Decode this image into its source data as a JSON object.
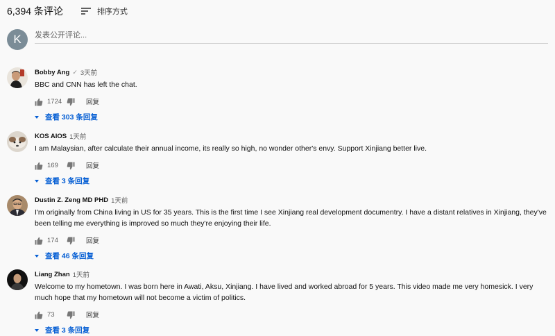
{
  "header": {
    "comment_count": "6,394 条评论",
    "sort_label": "排序方式",
    "sort_icon": "sort-icon"
  },
  "composer": {
    "avatar_letter": "K",
    "placeholder": "发表公开评论..."
  },
  "comments": [
    {
      "author": "Bobby Ang",
      "verified_icon": "✓",
      "time": "3天前",
      "text": "BBC and CNN has left the chat.",
      "likes": "1724",
      "reply_label": "回复",
      "replies_label": "查看 303 条回复"
    },
    {
      "author": "KOS AIOS",
      "time": "1天前",
      "text": "I am Malaysian, after calculate their annual income, its really so high, no wonder other's envy. Support Xinjiang better live.",
      "likes": "169",
      "reply_label": "回复",
      "replies_label": "查看 3 条回复"
    },
    {
      "author": "Dustin Z. Zeng MD PHD",
      "time": "1天前",
      "text": "I'm originally from China living in US for 35 years. This is the first time I see Xinjiang real development documentry. I have a distant relatives in Xinjiang, they've been telling me everything is improved so much they're enjoying their life.",
      "likes": "174",
      "reply_label": "回复",
      "replies_label": "查看 46 条回复"
    },
    {
      "author": "Liang Zhan",
      "time": "1天前",
      "text": "Welcome to my hometown. I was born here in Awati, Aksu, Xinjiang. I have lived and worked abroad for 5 years. This video made me very homesick. I very much hope that my hometown will not become a victim of politics.",
      "likes": "73",
      "reply_label": "回复",
      "replies_label": "查看 3 条回复"
    }
  ],
  "colors": {
    "link_blue": "#065fd4",
    "avatar_k_bg": "#7b8c97"
  }
}
